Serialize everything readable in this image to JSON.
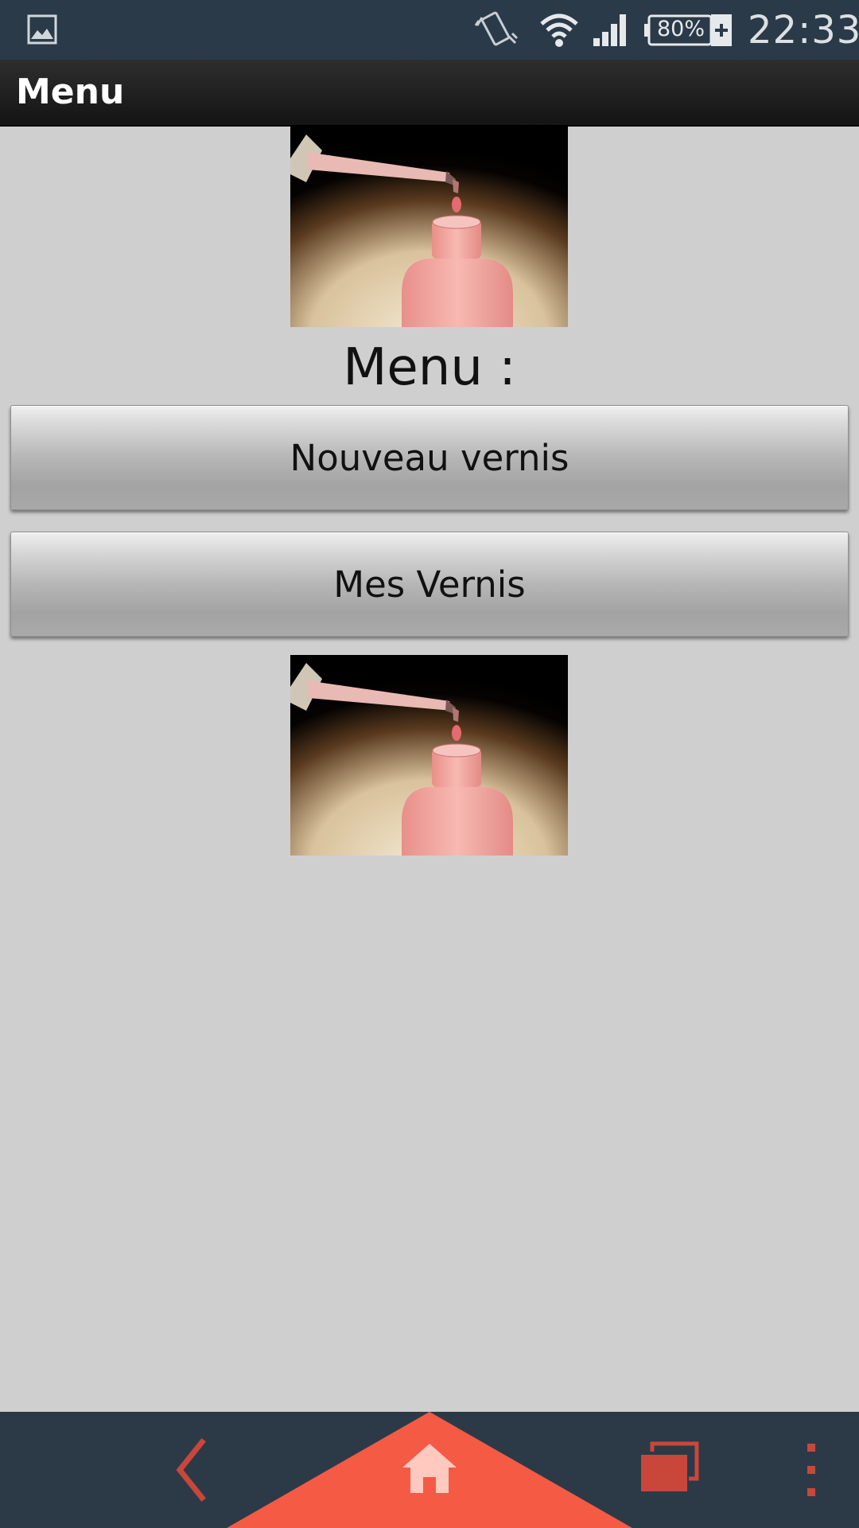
{
  "status_bar": {
    "battery_level": "80%",
    "time": "22:33",
    "icons": [
      "gallery-icon",
      "vibrate-icon",
      "wifi-icon",
      "signal-icon",
      "battery-charging-icon"
    ]
  },
  "action_bar": {
    "title": "Menu"
  },
  "main": {
    "heading": "Menu :",
    "buttons": {
      "new_polish": "Nouveau vernis",
      "my_polishes": "Mes Vernis"
    },
    "images": [
      "nail-polish-image",
      "nail-polish-image"
    ]
  },
  "nav_bar": {
    "icons": [
      "back-icon",
      "home-icon",
      "recents-icon",
      "overflow-menu-icon"
    ]
  },
  "colors": {
    "status_bar_bg": "#2b3a48",
    "nav_bar_bg": "#2c3a47",
    "accent": "#f55a45",
    "screen_bg": "#cfcfcf"
  }
}
